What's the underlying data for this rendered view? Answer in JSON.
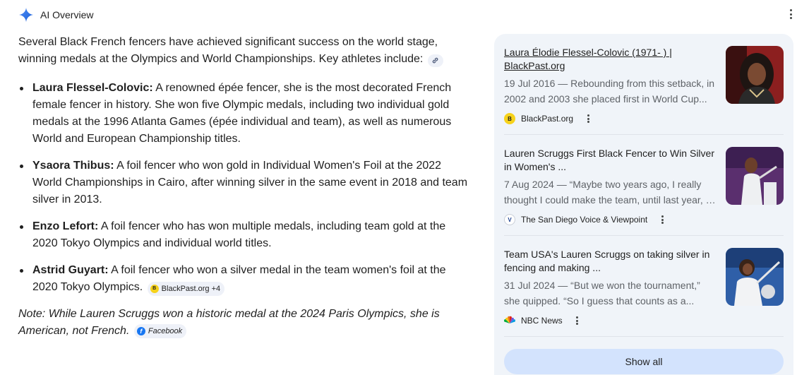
{
  "header": {
    "title": "AI Overview",
    "icon": "gemini-spark-icon"
  },
  "main": {
    "intro": "Several Black French fencers have achieved significant success on the world stage, winning medals at the Olympics and World Championships. Key athletes include:",
    "bullets": [
      {
        "name": "Laura Flessel-Colovic:",
        "text": " A renowned épée fencer, she is the most decorated French female fencer in history. She won five Olympic medals, including two individual gold medals at the 1996 Atlanta Games (épée individual and team), as well as numerous World and European Championship titles."
      },
      {
        "name": "Ysaora Thibus:",
        "text": " A foil fencer who won gold in Individual Women's Foil at the 2022 World Championships in Cairo, after winning silver in the same event in 2018 and team silver in 2013."
      },
      {
        "name": "Enzo Lefort:",
        "text": " A foil fencer who has won multiple medals, including team gold at the 2020 Tokyo Olympics and individual world titles."
      },
      {
        "name": "Astrid Guyart:",
        "text": " A foil fencer who won a silver medal in the team women's foil at the 2020 Tokyo Olympics."
      }
    ],
    "bullet_chip": "BlackPast.org +4",
    "note": "Note: While Lauren Scruggs won a historic medal at the 2024 Paris Olympics, she is American, not French.",
    "note_chip": "Facebook"
  },
  "sources": [
    {
      "title": "Laura Élodie Flessel-Colovic (1971- ) | BlackPast.org",
      "snippet1": "19 Jul 2016 — Rebounding from this setback, in",
      "snippet2": "2002 and 2003 she placed first in World Cup...",
      "site": "BlackPast.org",
      "fav_color": "#f6d21b"
    },
    {
      "title": "Lauren Scruggs First Black Fencer to Win Silver in Women's ...",
      "snippet1": "7 Aug 2024 — “Maybe two years ago, I really",
      "snippet2": "thought I could make the team, until last year, I...",
      "site": "The San Diego Voice & Viewpoint",
      "fav_color": "#1a3f8f"
    },
    {
      "title": "Team USA's Lauren Scruggs on taking silver in fencing and making ...",
      "snippet1": "31 Jul 2024 — “But we won the tournament,”",
      "snippet2": "she quipped. “So I guess that counts as a...",
      "site": "NBC News",
      "fav_color": "#e1251b"
    }
  ],
  "show_all": "Show all"
}
